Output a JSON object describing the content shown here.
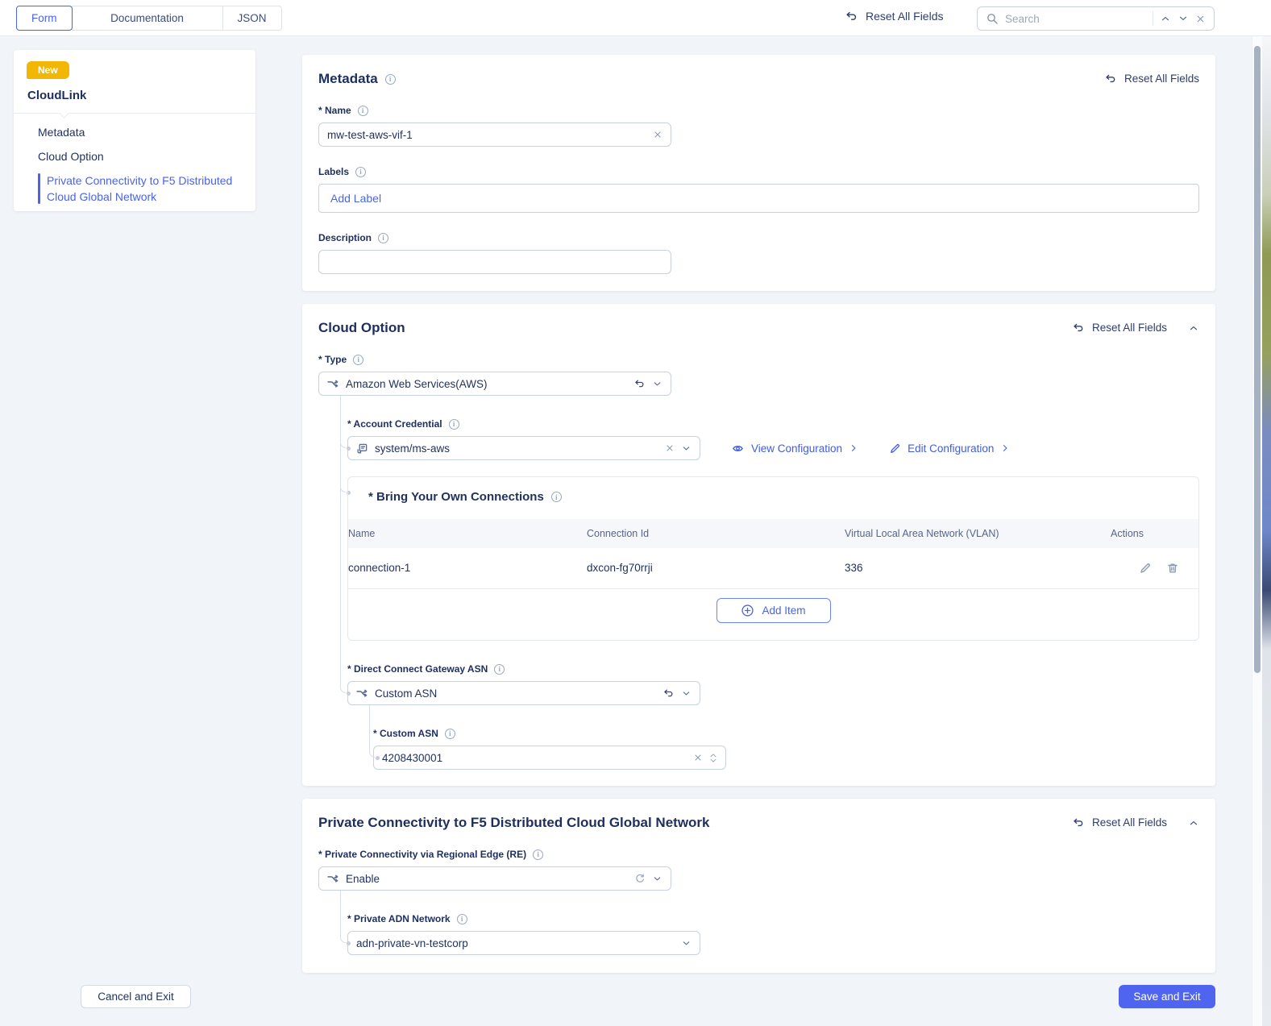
{
  "topbar": {
    "tabs": [
      "Form",
      "Documentation",
      "JSON"
    ],
    "reset_all_label": "Reset All Fields",
    "search_placeholder": "Search"
  },
  "sidebar": {
    "badge": "New",
    "title": "CloudLink",
    "items": [
      "Metadata",
      "Cloud Option",
      "Private Connectivity to F5 Distributed Cloud Global Network"
    ],
    "active_item": "Private Connectivity to F5 Distributed Cloud Global Network"
  },
  "metadata": {
    "title": "Metadata",
    "reset_label": "Reset All Fields",
    "name_label": "* Name",
    "name_value": "mw-test-aws-vif-1",
    "labels_label": "Labels",
    "add_label_placeholder": "Add Label",
    "description_label": "Description",
    "description_value": ""
  },
  "cloud_option": {
    "title": "Cloud Option",
    "reset_label": "Reset All Fields",
    "type_label": "* Type",
    "type_value": "Amazon Web Services(AWS)",
    "account_credential_label": "* Account Credential",
    "account_credential_value": "system/ms-aws",
    "view_configuration_label": "View Configuration",
    "edit_configuration_label": "Edit Configuration",
    "byoc_title": "* Bring Your Own Connections",
    "byoc_columns": [
      "Name",
      "Connection Id",
      "Virtual Local Area Network (VLAN)",
      "Actions"
    ],
    "byoc_rows": [
      {
        "name": "connection-1",
        "connection_id": "dxcon-fg70rrji",
        "vlan": "336"
      }
    ],
    "add_item_label": "Add Item",
    "dcg_asn_label": "* Direct Connect Gateway ASN",
    "dcg_asn_value": "Custom ASN",
    "custom_asn_label": "* Custom ASN",
    "custom_asn_value": "4208430001"
  },
  "private_connectivity": {
    "title": "Private Connectivity to F5 Distributed Cloud Global Network",
    "reset_label": "Reset All Fields",
    "re_label": "* Private Connectivity via Regional Edge (RE)",
    "re_value": "Enable",
    "adn_label": "* Private ADN Network",
    "adn_value": "adn-private-vn-testcorp"
  },
  "footer": {
    "cancel_label": "Cancel and Exit",
    "save_label": "Save and Exit"
  },
  "colors": {
    "accent": "#3f5ce5",
    "primary_button": "#5065ef",
    "badge": "#f2b705",
    "heading_text": "#1d2f5e"
  }
}
